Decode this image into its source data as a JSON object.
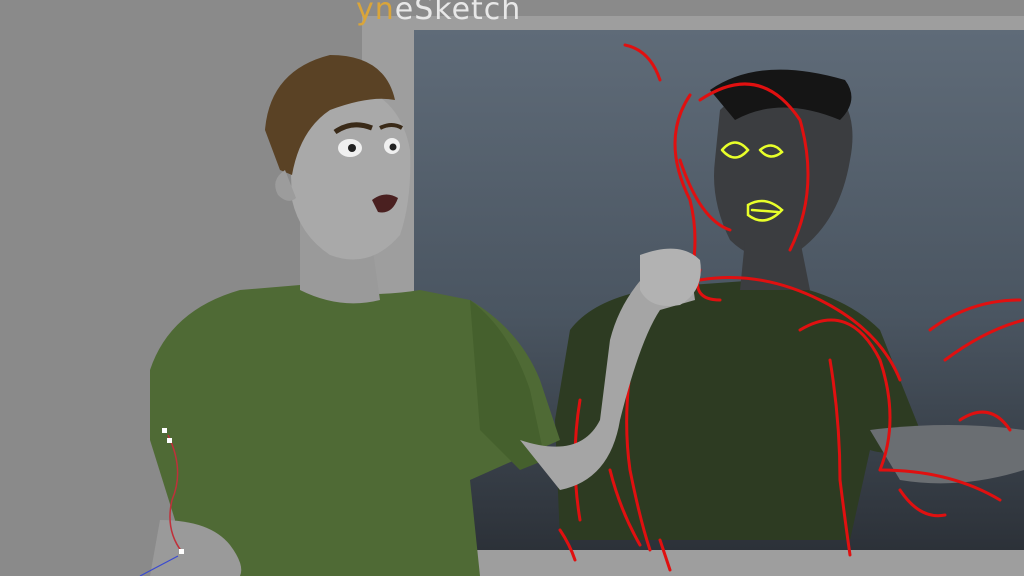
{
  "app": {
    "brand_accent": "yn",
    "brand_rest": "eSketch"
  },
  "colors": {
    "viewport_bg": "#8a8a8a",
    "shirt": "#4f6a35",
    "skin": "#a8a8a8",
    "hair": "#5a4225",
    "sketch_red": "#e01010",
    "sketch_yellow": "#e8ff2a"
  }
}
